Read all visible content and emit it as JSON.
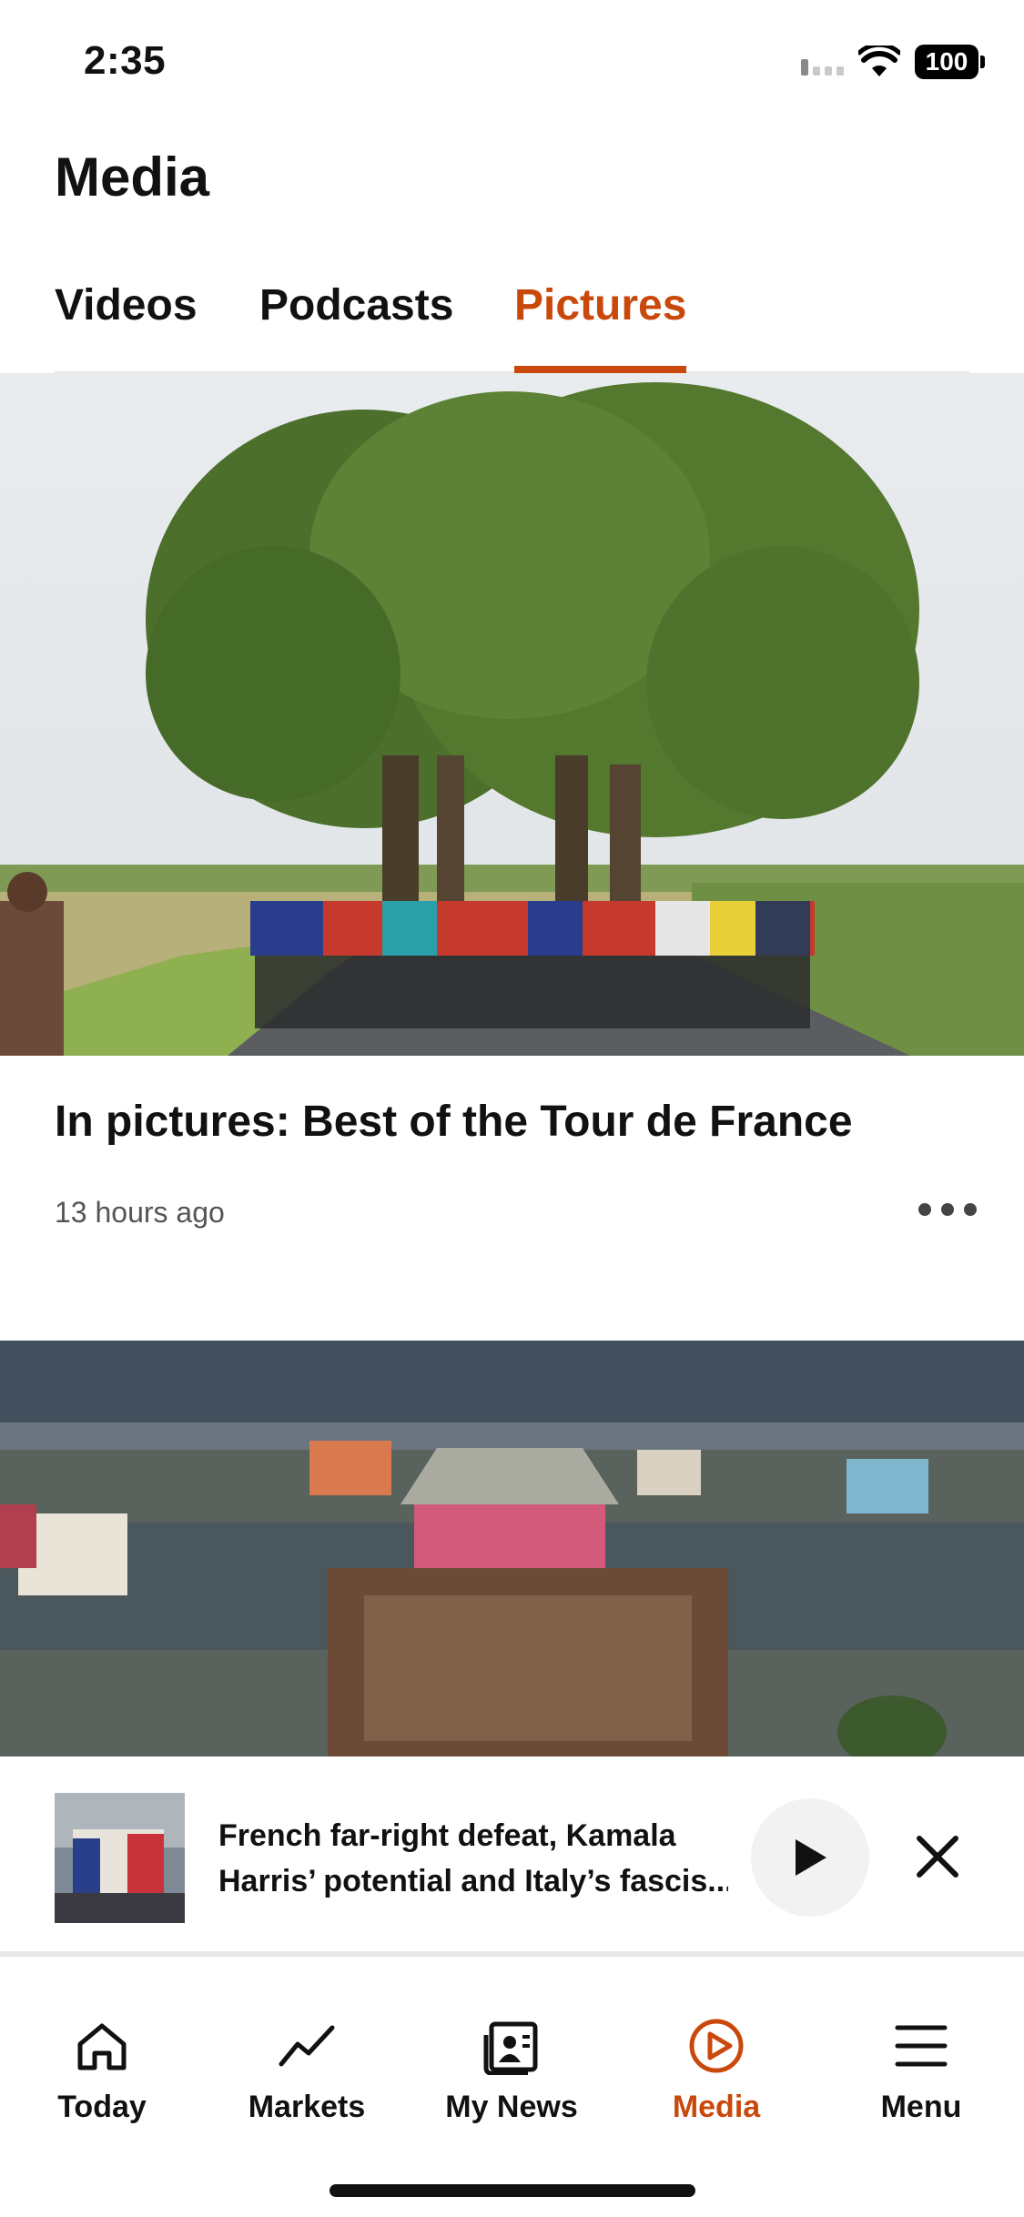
{
  "status_bar": {
    "time": "2:35",
    "battery": "100"
  },
  "header": {
    "title": "Media"
  },
  "tabs": [
    {
      "label": "Videos",
      "active": false
    },
    {
      "label": "Podcasts",
      "active": false
    },
    {
      "label": "Pictures",
      "active": true
    }
  ],
  "stories": [
    {
      "title": "In pictures: Best of the Tour de France",
      "time": "13 hours ago"
    }
  ],
  "mini_player": {
    "line1": "French far-right defeat, Kamala",
    "line2": "Harris’ potential and Italy’s fascis..."
  },
  "bottom_nav": [
    {
      "label": "Today",
      "icon": "home-icon"
    },
    {
      "label": "Markets",
      "icon": "chart-line-icon"
    },
    {
      "label": "My News",
      "icon": "news-icon"
    },
    {
      "label": "Media",
      "icon": "play-circle-icon",
      "active": true
    },
    {
      "label": "Menu",
      "icon": "hamburger-icon"
    }
  ],
  "colors": {
    "accent": "#c9490c",
    "text": "#111111",
    "muted": "#555555"
  }
}
